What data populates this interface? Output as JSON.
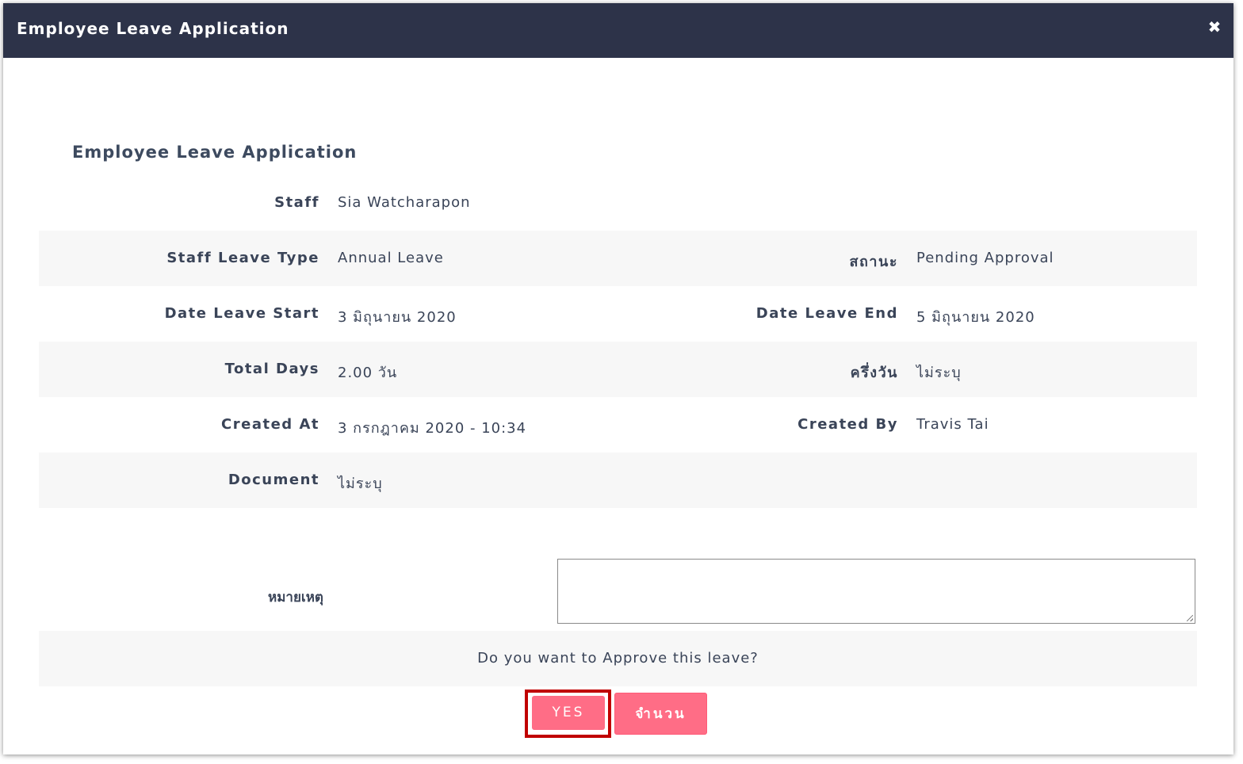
{
  "dialog": {
    "title": "Employee Leave Application",
    "close_icon": "close-icon"
  },
  "section_title": "Employee Leave Application",
  "fields": {
    "staff": {
      "label": "Staff",
      "value": "Sia Watcharapon"
    },
    "leave_type": {
      "label": "Staff Leave Type",
      "value": "Annual Leave"
    },
    "status": {
      "label": "สถานะ",
      "value": "Pending Approval"
    },
    "date_start": {
      "label": "Date Leave Start",
      "value": "3 มิถุนายน 2020"
    },
    "date_end": {
      "label": "Date Leave End",
      "value": "5 มิถุนายน 2020"
    },
    "total_days": {
      "label": "Total Days",
      "value": "2.00 วัน"
    },
    "half_day": {
      "label": "ครึ่งวัน",
      "value": "ไม่ระบุ"
    },
    "created_at": {
      "label": "Created At",
      "value": "3 กรกฎาคม 2020 - 10:34"
    },
    "created_by": {
      "label": "Created By",
      "value": "Travis Tai"
    },
    "document": {
      "label": "Document",
      "value": "ไม่ระบุ"
    }
  },
  "remark": {
    "label": "หมายเหตุ",
    "value": ""
  },
  "confirm": {
    "question": "Do you want to Approve this leave?",
    "yes_label": "YES",
    "cancel_label": "จำนวน"
  },
  "colors": {
    "header_bg": "#2d3349",
    "button_bg": "#ff6d86",
    "highlight_border": "#c00000",
    "row_shade": "#f7f7f7"
  }
}
